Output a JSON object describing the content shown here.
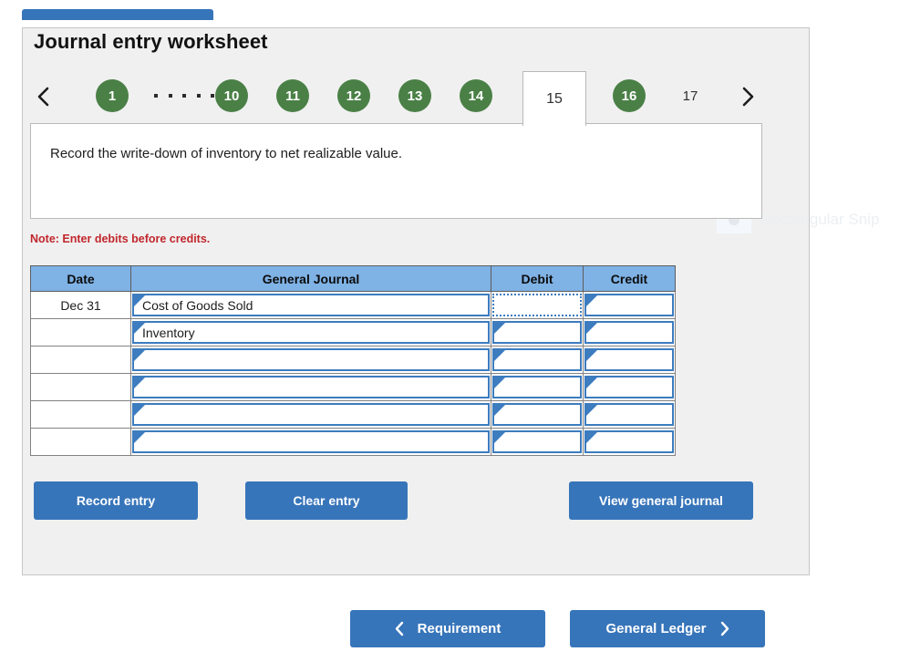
{
  "colors": {
    "brand_blue": "#3775ba",
    "header_blue": "#7fb2e5",
    "pill_green": "#4a8046",
    "note_red": "#c0272d",
    "cell_border_blue": "#3c7cbf",
    "panel_bg": "#f0f0f0"
  },
  "panel": {
    "title": "Journal entry worksheet"
  },
  "tabnav": {
    "prev_icon": "chevron-left-icon",
    "next_icon": "chevron-right-icon",
    "ellipsis": "•••••",
    "tabs": [
      {
        "label": "1",
        "state": "complete"
      },
      {
        "label": "10",
        "state": "complete"
      },
      {
        "label": "11",
        "state": "complete"
      },
      {
        "label": "12",
        "state": "complete"
      },
      {
        "label": "13",
        "state": "complete"
      },
      {
        "label": "14",
        "state": "complete"
      },
      {
        "label": "15",
        "state": "active"
      },
      {
        "label": "16",
        "state": "complete"
      },
      {
        "label": "17",
        "state": "pending"
      }
    ],
    "active_tab": "15"
  },
  "instruction": {
    "text": "Record the write-down of inventory to net realizable value."
  },
  "note": "Note: Enter debits before credits.",
  "journal": {
    "columns": [
      "Date",
      "General Journal",
      "Debit",
      "Credit"
    ],
    "rows": [
      {
        "date": "Dec 31",
        "account": "Cost of Goods Sold",
        "debit": "",
        "credit": "",
        "debit_focused": true
      },
      {
        "date": "",
        "account": "Inventory",
        "debit": "",
        "credit": "",
        "debit_focused": false
      },
      {
        "date": "",
        "account": "",
        "debit": "",
        "credit": "",
        "debit_focused": false
      },
      {
        "date": "",
        "account": "",
        "debit": "",
        "credit": "",
        "debit_focused": false
      },
      {
        "date": "",
        "account": "",
        "debit": "",
        "credit": "",
        "debit_focused": false
      },
      {
        "date": "",
        "account": "",
        "debit": "",
        "credit": "",
        "debit_focused": false
      }
    ]
  },
  "actions": {
    "record_entry": "Record entry",
    "clear_entry": "Clear entry",
    "view_general_journal": "View general journal"
  },
  "bottom_nav": {
    "requirement": "Requirement",
    "general_ledger": "General Ledger",
    "prev_icon": "chevron-left-icon",
    "next_icon": "chevron-right-icon"
  },
  "overlay": {
    "snip_label": "Rectangular Snip"
  }
}
